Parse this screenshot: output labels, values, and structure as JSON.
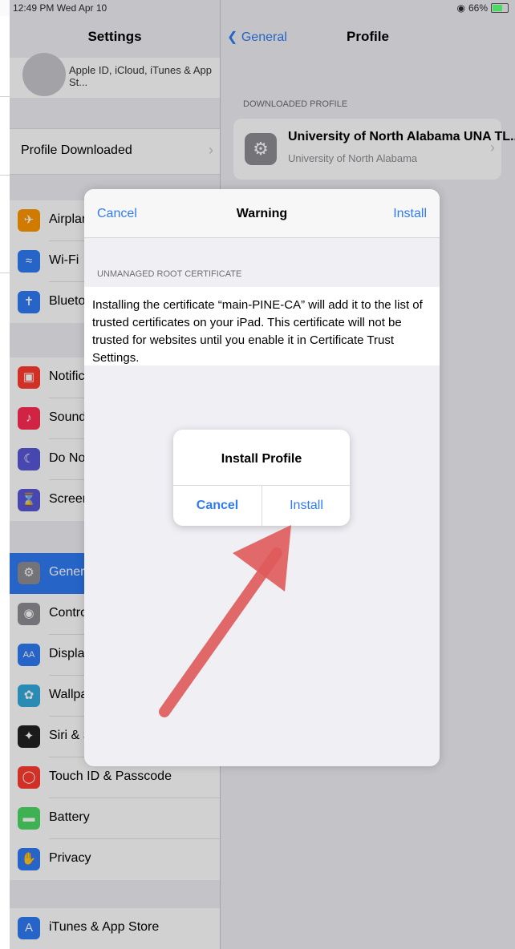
{
  "status_bar": {
    "time": "12:49 PM  Wed Apr 10",
    "battery": "66%"
  },
  "left_pane": {
    "title": "Settings",
    "apple_id_text": "Apple ID, iCloud, iTunes & App St...",
    "profile_downloaded": "Profile Downloaded",
    "group1": [
      {
        "label": "Airplane Mode",
        "icon": "airplane-icon",
        "color": "#ff9500"
      },
      {
        "label": "Wi-Fi",
        "icon": "wifi-icon",
        "color": "#2f7bf5"
      },
      {
        "label": "Bluetooth",
        "icon": "bluetooth-icon",
        "color": "#2f7bf5"
      }
    ],
    "group2": [
      {
        "label": "Notifications",
        "icon": "notifications-icon",
        "color": "#ff3b30"
      },
      {
        "label": "Sounds",
        "icon": "sounds-icon",
        "color": "#ff2d55"
      },
      {
        "label": "Do Not Disturb",
        "icon": "moon-icon",
        "color": "#5856d6"
      },
      {
        "label": "Screen Time",
        "icon": "hourglass-icon",
        "color": "#5856d6"
      }
    ],
    "group3": [
      {
        "label": "General",
        "icon": "gear-icon",
        "color": "#8e8e93"
      },
      {
        "label": "Control Center",
        "icon": "toggles-icon",
        "color": "#8e8e93"
      },
      {
        "label": "Display & Brightness",
        "icon": "display-icon",
        "color": "#2f7bf5"
      },
      {
        "label": "Wallpaper",
        "icon": "wallpaper-icon",
        "color": "#34aadc"
      },
      {
        "label": "Siri & Search",
        "icon": "siri-icon",
        "color": "#222222"
      },
      {
        "label": "Touch ID & Passcode",
        "icon": "fingerprint-icon",
        "color": "#ff3b30"
      },
      {
        "label": "Battery",
        "icon": "battery-icon",
        "color": "#4cd964"
      },
      {
        "label": "Privacy",
        "icon": "hand-icon",
        "color": "#2f7bf5"
      }
    ],
    "group4": [
      {
        "label": "iTunes & App Store",
        "icon": "app-store-icon",
        "color": "#2f7bf5"
      }
    ]
  },
  "right_pane": {
    "back_label": "General",
    "title": "Profile",
    "section_label": "DOWNLOADED PROFILE",
    "profile_name": "University of North Alabama UNA TL...",
    "profile_org": "University of North Alabama"
  },
  "warning_sheet": {
    "cancel": "Cancel",
    "title": "Warning",
    "install": "Install",
    "section": "UNMANAGED ROOT CERTIFICATE",
    "body": "Installing the certificate “main-PINE-CA” will add it to the list of trusted certificates on your iPad. This certificate will not be trusted for websites until you enable it in Certificate Trust Settings."
  },
  "alert": {
    "title": "Install Profile",
    "cancel": "Cancel",
    "install": "Install"
  },
  "colors": {
    "accent": "#2f7bf5",
    "arrow": "#e05a5a"
  }
}
